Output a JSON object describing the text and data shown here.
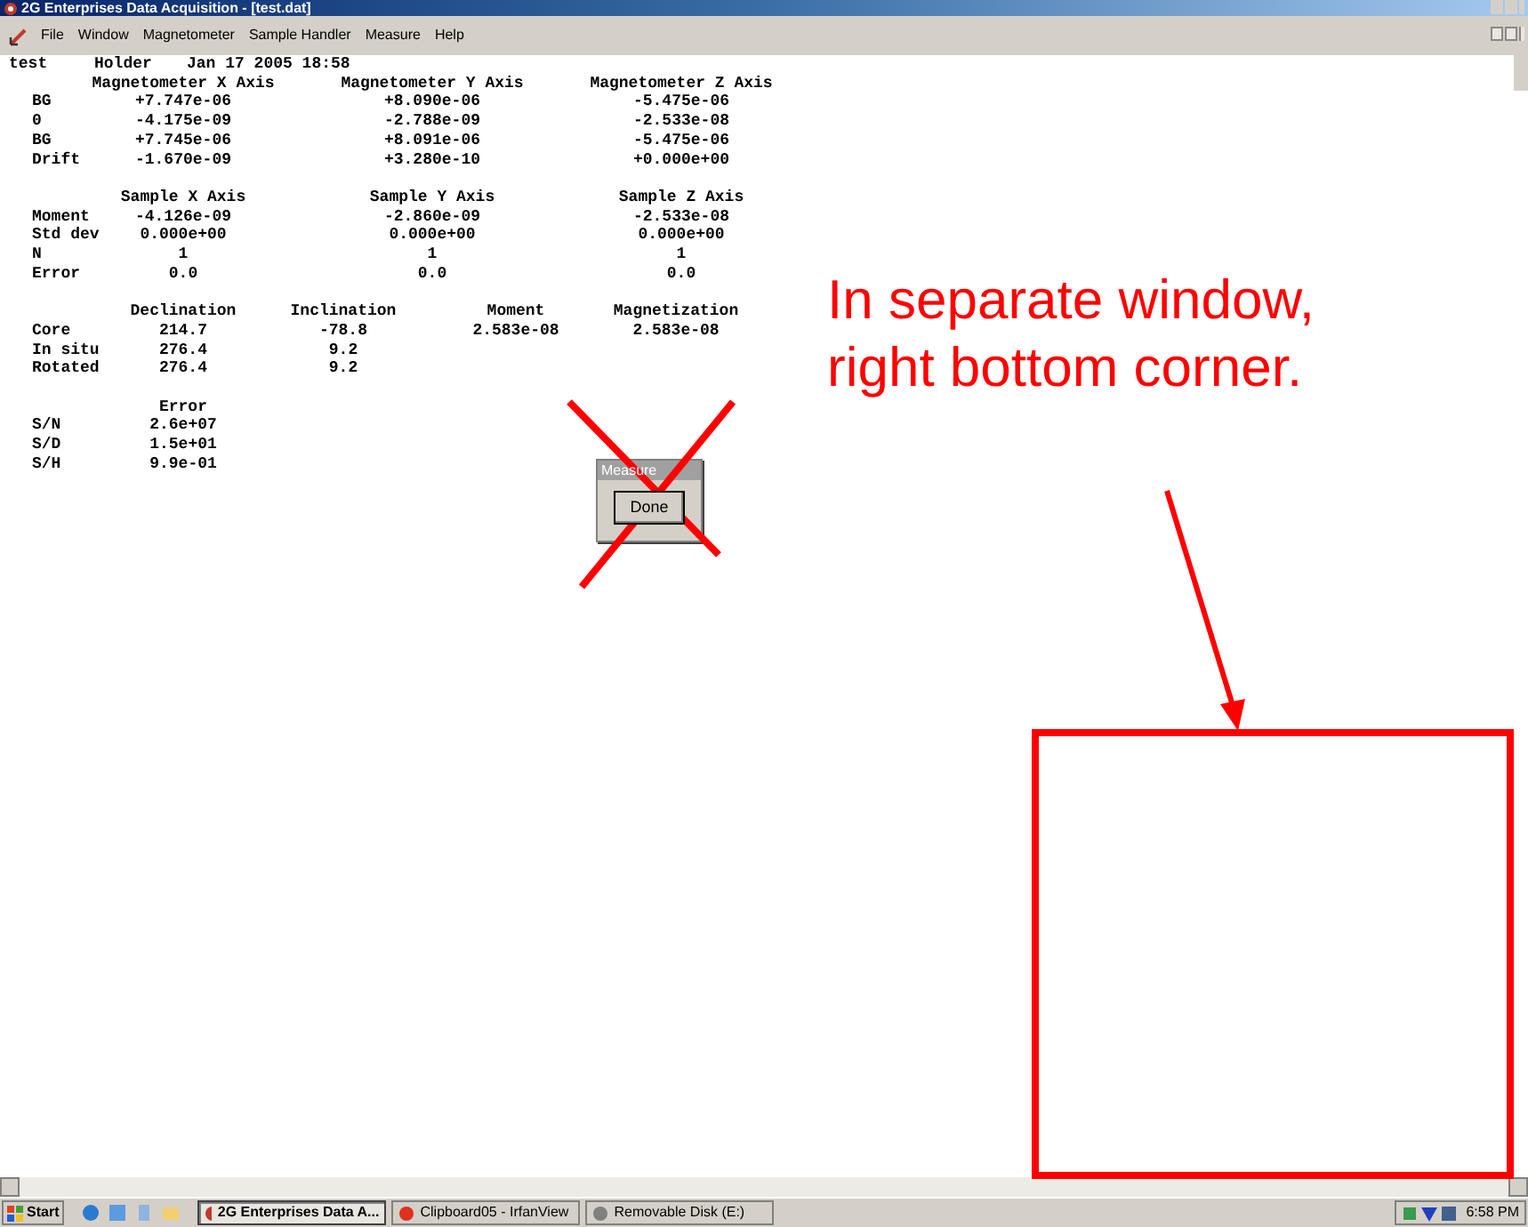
{
  "window": {
    "title": "2G Enterprises Data Acquisition - [test.dat]"
  },
  "menu": [
    "File",
    "Window",
    "Magnetometer",
    "Sample Handler",
    "Measure",
    "Help"
  ],
  "header": {
    "file": "test",
    "holder": "Holder",
    "timestamp": "Jan 17 2005 18:58"
  },
  "sections": [
    {
      "columns": [
        "Magnetometer X Axis",
        "Magnetometer Y Axis",
        "Magnetometer Z Axis"
      ],
      "rows": [
        {
          "label": "BG",
          "values": [
            "+7.747e-06",
            "+8.090e-06",
            "-5.475e-06"
          ]
        },
        {
          "label": "0",
          "values": [
            "-4.175e-09",
            "-2.788e-09",
            "-2.533e-08"
          ]
        },
        {
          "label": "BG",
          "values": [
            "+7.745e-06",
            "+8.091e-06",
            "-5.475e-06"
          ]
        },
        {
          "label": "Drift",
          "values": [
            "-1.670e-09",
            "+3.280e-10",
            "+0.000e+00"
          ]
        }
      ]
    },
    {
      "columns": [
        "Sample X Axis",
        "Sample Y Axis",
        "Sample Z Axis"
      ],
      "rows": [
        {
          "label": "Moment",
          "values": [
            "-4.126e-09",
            "-2.860e-09",
            "-2.533e-08"
          ]
        },
        {
          "label": "Std dev",
          "values": [
            "0.000e+00",
            "0.000e+00",
            "0.000e+00"
          ]
        },
        {
          "label": "N",
          "values": [
            "1",
            "1",
            "1"
          ]
        },
        {
          "label": "Error",
          "values": [
            "0.0",
            "0.0",
            "0.0"
          ]
        }
      ]
    },
    {
      "columns": [
        "Declination",
        "Inclination",
        "Moment",
        "Magnetization"
      ],
      "rows": [
        {
          "label": "Core",
          "values": [
            "214.7",
            "-78.8",
            "2.583e-08",
            "2.583e-08"
          ]
        },
        {
          "label": "In situ",
          "values": [
            "276.4",
            "9.2"
          ]
        },
        {
          "label": "Rotated",
          "values": [
            "276.4",
            "9.2"
          ]
        }
      ]
    },
    {
      "columns": [
        "Error"
      ],
      "rows": [
        {
          "label": "S/N",
          "values": [
            "2.6e+07"
          ]
        },
        {
          "label": "S/D",
          "values": [
            "1.5e+01"
          ]
        },
        {
          "label": "S/H",
          "values": [
            "9.9e-01"
          ]
        }
      ]
    }
  ],
  "dialog": {
    "title": "Measure",
    "button": "Done"
  },
  "annotation": {
    "lines": [
      "In separate window,",
      "right bottom corner."
    ]
  },
  "taskbar": {
    "start": "Start",
    "tasks": [
      {
        "label": "2G Enterprises Data A...",
        "selected": true
      },
      {
        "label": "Clipboard05 - IrfanView",
        "selected": false
      },
      {
        "label": "Removable Disk (E:)",
        "selected": false
      }
    ],
    "clock": "6:58 PM"
  }
}
